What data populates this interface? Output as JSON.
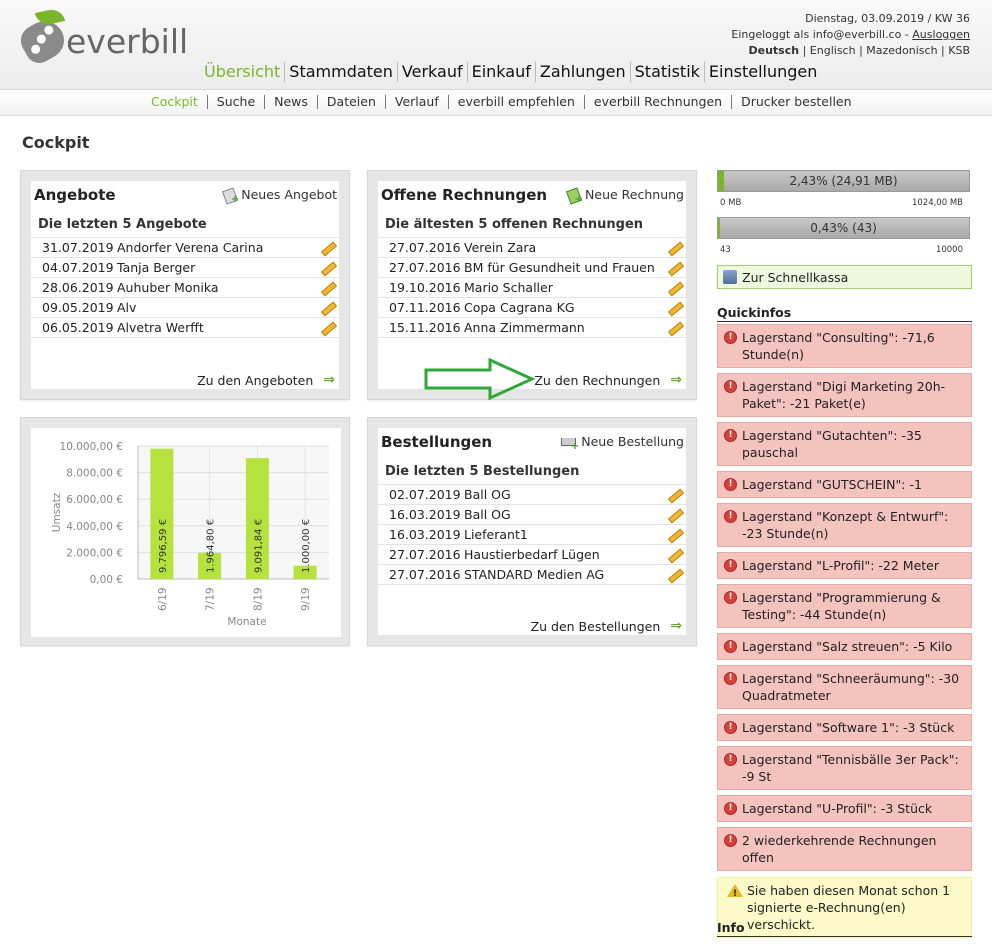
{
  "header": {
    "logo_text": "everbill",
    "date_line": "Dienstag, 03.09.2019 / KW 36",
    "login_prefix": "Eingeloggt als info@everbill.co - ",
    "logout": "Ausloggen",
    "languages": [
      "Deutsch",
      "Englisch",
      "Mazedonisch",
      "KSB"
    ],
    "main_nav": [
      "Übersicht",
      "Stammdaten",
      "Verkauf",
      "Einkauf",
      "Zahlungen",
      "Statistik",
      "Einstellungen"
    ],
    "sub_nav": [
      "Cockpit",
      "Suche",
      "News",
      "Dateien",
      "Verlauf",
      "everbill empfehlen",
      "everbill Rechnungen",
      "Drucker bestellen"
    ]
  },
  "page_title": "Cockpit",
  "angebote": {
    "title": "Angebote",
    "action": "Neues Angebot",
    "subtitle": "Die letzten 5 Angebote",
    "rows": [
      {
        "date": "31.07.2019",
        "name": "Andorfer Verena Carina"
      },
      {
        "date": "04.07.2019",
        "name": "Tanja Berger"
      },
      {
        "date": "28.06.2019",
        "name": "Auhuber Monika"
      },
      {
        "date": "09.05.2019",
        "name": "Alv"
      },
      {
        "date": "06.05.2019",
        "name": "Alvetra Werfft"
      }
    ],
    "footer": "Zu den Angeboten"
  },
  "rechnungen": {
    "title": "Offene Rechnungen",
    "action": "Neue Rechnung",
    "subtitle": "Die ältesten 5 offenen Rechnungen",
    "rows": [
      {
        "date": "27.07.2016",
        "name": "Verein Zara"
      },
      {
        "date": "27.07.2016",
        "name": "BM für Gesundheit und Frauen"
      },
      {
        "date": "19.10.2016",
        "name": "Mario Schaller"
      },
      {
        "date": "07.11.2016",
        "name": "Copa Cagrana KG"
      },
      {
        "date": "15.11.2016",
        "name": "Anna Zimmermann"
      }
    ],
    "footer": "Zu den Rechnungen"
  },
  "bestellungen": {
    "title": "Bestellungen",
    "action": "Neue Bestellung",
    "subtitle": "Die letzten 5 Bestellungen",
    "rows": [
      {
        "date": "02.07.2019",
        "name": "Ball OG"
      },
      {
        "date": "16.03.2019",
        "name": "Ball OG"
      },
      {
        "date": "16.03.2019",
        "name": "Lieferant1"
      },
      {
        "date": "27.07.2016",
        "name": "Haustierbedarf Lügen"
      },
      {
        "date": "27.07.2016",
        "name": "STANDARD Medien AG"
      }
    ],
    "footer": "Zu den Bestellungen"
  },
  "chart_data": {
    "type": "bar",
    "categories": [
      "6/19",
      "7/19",
      "8/19",
      "9/19"
    ],
    "values": [
      9796.59,
      1964.8,
      9091.84,
      1000.0
    ],
    "value_labels": [
      "9.796,59 €",
      "1.964,80 €",
      "9.091,84 €",
      "1.000,00 €"
    ],
    "ylabel": "Umsatz",
    "xlabel": "Monate",
    "yticks": [
      "0,00 €",
      "2.000,00 €",
      "4.000,00 €",
      "6.000,00 €",
      "8.000,00 €",
      "10.000,00 €"
    ],
    "ylim": [
      0,
      10000
    ],
    "bar_color": "#b5e23d",
    "grid": true
  },
  "storage": {
    "label": "2,43% (24,91 MB)",
    "fill_fraction": 0.0243,
    "min": "0 MB",
    "max": "1024,00 MB"
  },
  "docs": {
    "label": "0,43% (43)",
    "fill_fraction": 0.0043,
    "min": "43",
    "max": "10000"
  },
  "schnellkassa": "Zur Schnellkassa",
  "quickinfos": {
    "title": "Quickinfos",
    "items": [
      "Lagerstand \"Consulting\": -71,6 Stunde(n)",
      "Lagerstand \"Digi Marketing 20h-Paket\": -21 Paket(e)",
      "Lagerstand \"Gutachten\": -35 pauschal",
      "Lagerstand \"GUTSCHEIN\": -1",
      "Lagerstand \"Konzept & Entwurf\": -23 Stunde(n)",
      "Lagerstand \"L-Profil\": -22 Meter",
      "Lagerstand \"Programmierung & Testing\": -44 Stunde(n)",
      "Lagerstand \"Salz streuen\": -5 Kilo",
      "Lagerstand \"Schneeräumung\": -30 Quadratmeter",
      "Lagerstand \"Software 1\": -3 Stück",
      "Lagerstand \"Tennisbälle 3er Pack\": -9 St",
      "Lagerstand \"U-Profil\": -3 Stück",
      "2 wiederkehrende Rechnungen offen"
    ],
    "warning": "Sie haben diesen Monat schon 1 signierte e-Rechnung(en) verschickt."
  },
  "info": {
    "title": "Info"
  },
  "colors": {
    "accent": "#7ab62b",
    "alert_bg": "#f4c3be",
    "warn_bg": "#fbfac8",
    "annotation_arrow": "#2fa83a"
  }
}
